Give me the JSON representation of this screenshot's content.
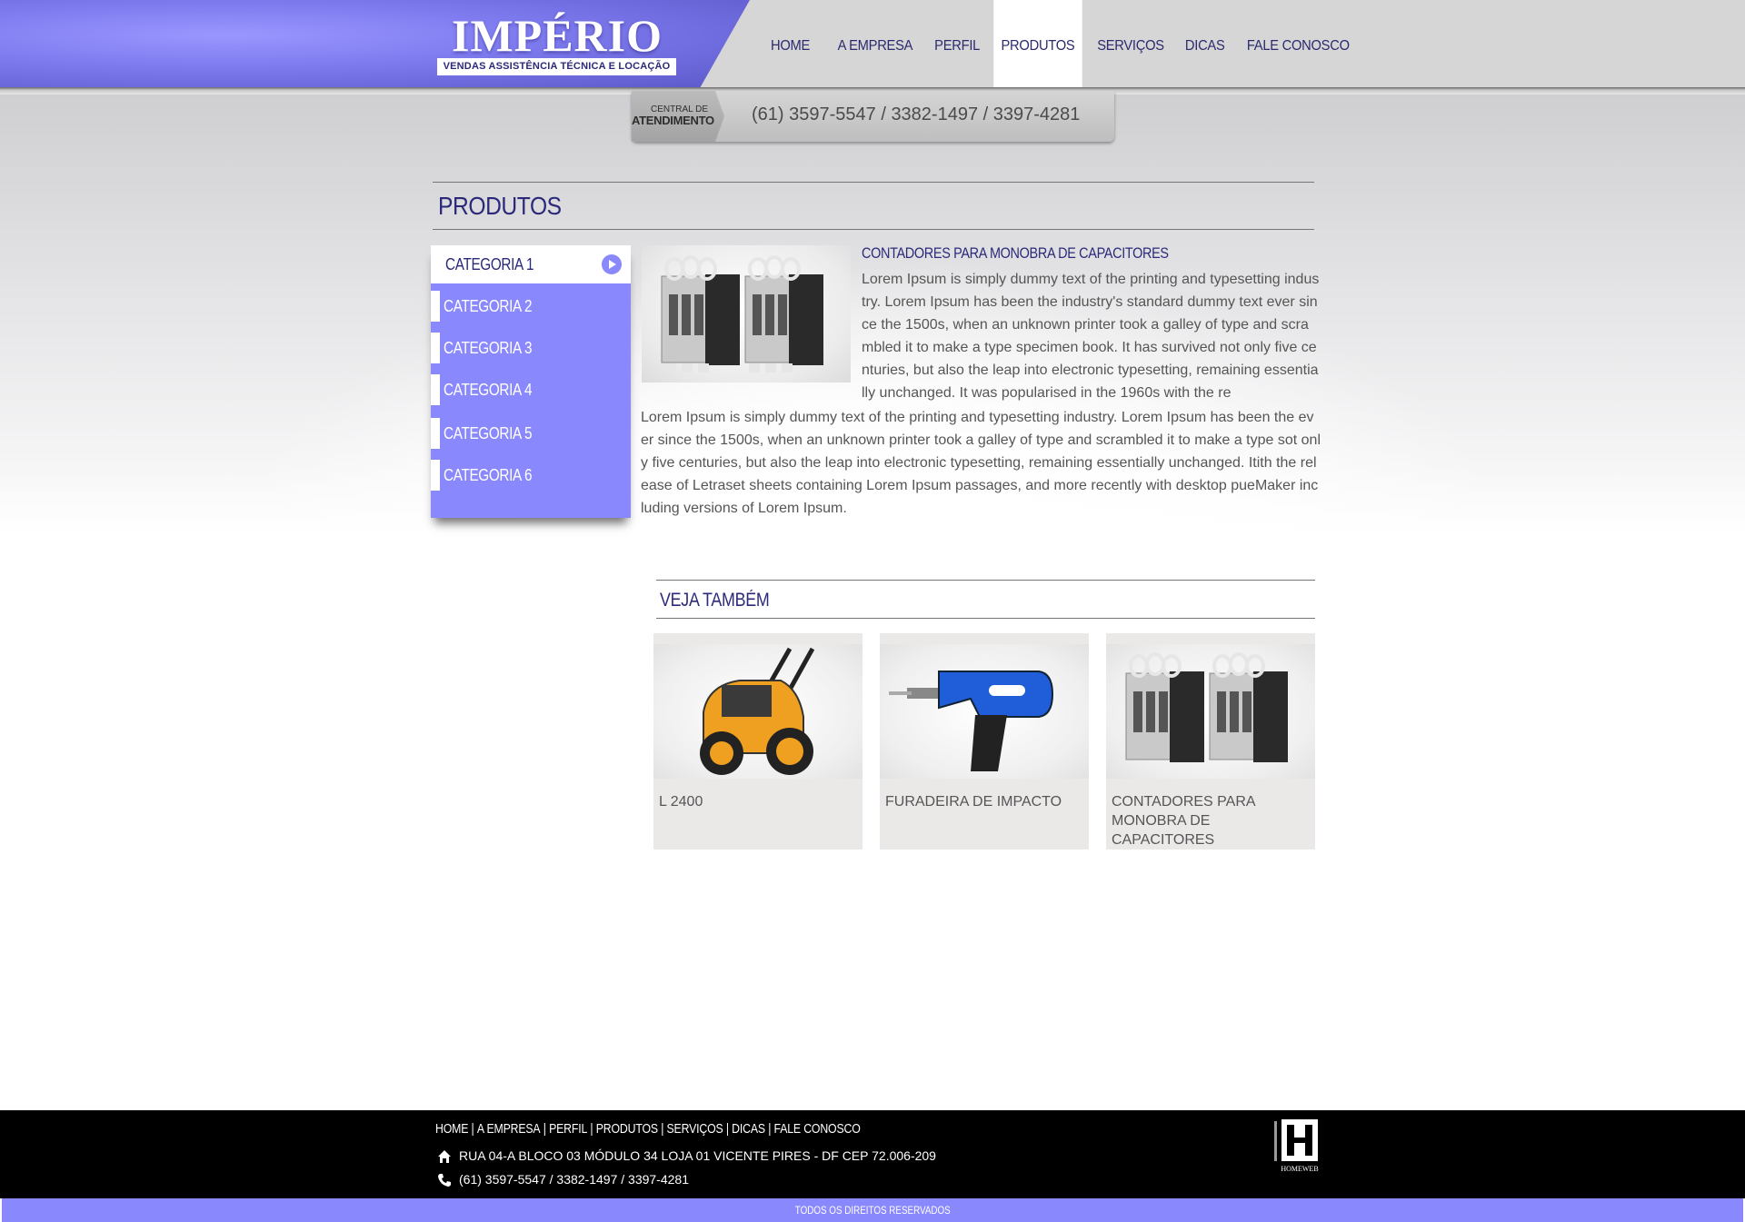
{
  "brand": {
    "name": "IMPÉRIO",
    "tagline": "VENDAS ASSISTÊNCIA TÉCNICA E LOCAÇÃO"
  },
  "nav": {
    "items": [
      {
        "label": "HOME"
      },
      {
        "label": "A EMPRESA"
      },
      {
        "label": "PERFIL"
      },
      {
        "label": "PRODUTOS",
        "active": true
      },
      {
        "label": "SERVIÇOS"
      },
      {
        "label": "DICAS"
      },
      {
        "label": "FALE CONOSCO"
      }
    ]
  },
  "call_center": {
    "label_line1": "CENTRAL DE",
    "label_line2": "ATENDIMENTO",
    "phones": "(61) 3597-5547 / 3382-1497 / 3397-4281"
  },
  "page": {
    "title": "PRODUTOS"
  },
  "sidebar": {
    "categories": [
      {
        "label": "CATEGORIA 1",
        "active": true
      },
      {
        "label": "CATEGORIA 2"
      },
      {
        "label": "CATEGORIA 3"
      },
      {
        "label": "CATEGORIA 4"
      },
      {
        "label": "CATEGORIA 5"
      },
      {
        "label": "CATEGORIA 6"
      }
    ]
  },
  "product": {
    "title": "CONTADORES PARA MONOBRA DE CAPACITORES",
    "description": "Lorem Ipsum is simply dummy text of the printing and typesetting industry. Lorem Ipsum has been the industry's standard dummy text ever since the 1500s, when an unknown printer took a galley of type and scrambled it to make a type specimen book. It has survived not only five centuries, but also the leap into electronic typesetting, remaining essentially unchanged. It was popularised in the 1960s with the re",
    "description_continued": "Lorem Ipsum is simply dummy text of the printing and typesetting industry. Lorem Ipsum has been the ever since the 1500s, when an unknown printer took a galley of type and scrambled it to make a type sot only five centuries, but also the leap into electronic typesetting, remaining essentially unchanged. Itith the release of Letraset sheets containing Lorem Ipsum passages, and more recently with desktop pueMaker including versions of Lorem Ipsum."
  },
  "related": {
    "title": "VEJA TAMBÉM",
    "items": [
      {
        "name": "L 2400",
        "icon": "pressure-washer-image"
      },
      {
        "name": "FURADEIRA DE IMPACTO",
        "icon": "impact-drill-image"
      },
      {
        "name": "CONTADORES PARA MONOBRA DE CAPACITORES",
        "icon": "capacitor-contactor-image"
      }
    ]
  },
  "footer": {
    "nav": [
      "HOME",
      "A EMPRESA",
      "PERFIL",
      "PRODUTOS",
      "SERVIÇOS",
      "DICAS",
      "FALE CONOSCO"
    ],
    "address": "RUA 04-A BLOCO 03 MÓDULO 34 LOJA 01 VICENTE PIRES - DF CEP 72.006-209",
    "phones": "(61) 3597-5547 / 3382-1497 / 3397-4281",
    "credit_logo": "HOMEWEB",
    "copyright": "TODOS OS DIREITOS RESERVADOS"
  },
  "colors": {
    "brand_purple": "#8a88fd",
    "title_navy": "#2b2a7a",
    "footer_black": "#000000"
  }
}
